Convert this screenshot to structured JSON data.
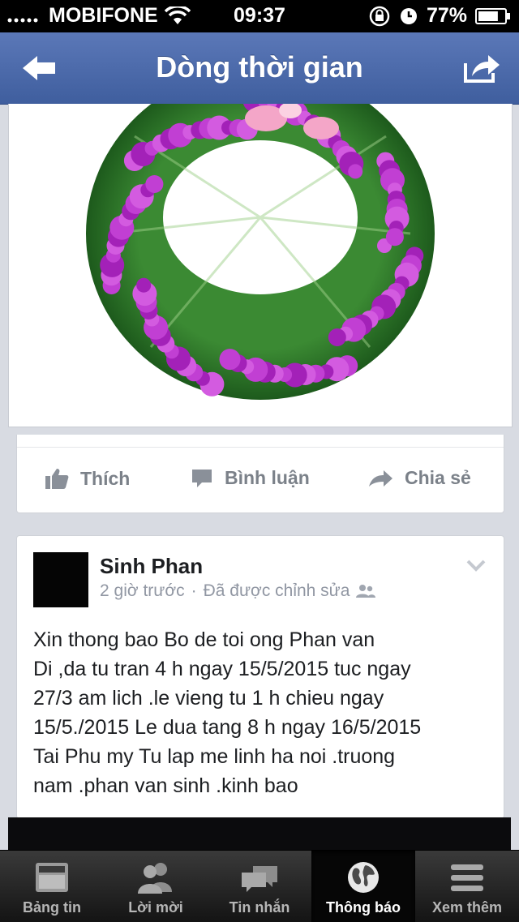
{
  "status_bar": {
    "carrier": "MOBIFONE",
    "time": "09:37",
    "battery": "77%",
    "battery_level": 0.77
  },
  "nav": {
    "title": "Dòng thời gian",
    "back_icon": "back-arrow-icon",
    "share_icon": "share-icon"
  },
  "actions": {
    "like": "Thích",
    "comment": "Bình luận",
    "share": "Chia sẻ"
  },
  "post": {
    "author": "Sinh Phan",
    "time": "2 giờ trước",
    "separator": "·",
    "edited": "Đã được chỉnh sửa",
    "text": "Xin thong bao Bo de  toi ong Phan van\nDi ,da tu tran 4 h ngay 15/5/2015 tuc ngay\n27/3 am lich .le vieng tu 1 h chieu ngay\n15/5./2015 Le dua tang 8 h ngay 16/5/2015\nTai Phu my Tu lap me linh ha noi .truong\nnam  .phan van sinh .kinh bao"
  },
  "tabs": [
    {
      "label": "Bảng tin",
      "icon": "news-feed-icon",
      "active": false
    },
    {
      "label": "Lời mời",
      "icon": "friend-requests-icon",
      "active": false
    },
    {
      "label": "Tin nhắn",
      "icon": "messages-icon",
      "active": false
    },
    {
      "label": "Thông báo",
      "icon": "notifications-globe-icon",
      "active": true
    },
    {
      "label": "Xem thêm",
      "icon": "more-menu-icon",
      "active": false
    }
  ],
  "colors": {
    "nav_blue": "#4a67a8",
    "wreath_orchid": "#b12fc8",
    "wreath_leaf": "#2f7a2a"
  }
}
